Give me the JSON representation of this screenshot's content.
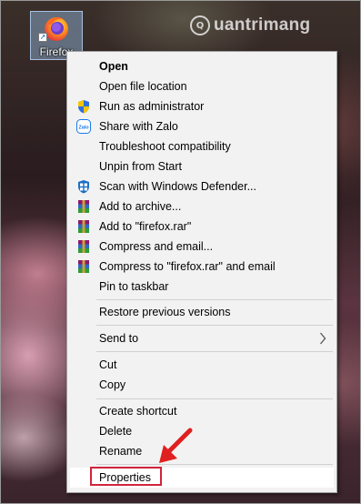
{
  "desktop": {
    "icon_label": "Firefox",
    "watermark_text": "uantrimang"
  },
  "menu": {
    "items": [
      {
        "label": "Open",
        "bold": true,
        "icon": "none"
      },
      {
        "label": "Open file location",
        "icon": "none"
      },
      {
        "label": "Run as administrator",
        "icon": "uac-shield-icon"
      },
      {
        "label": "Share with Zalo",
        "icon": "zalo-icon"
      },
      {
        "label": "Troubleshoot compatibility",
        "icon": "none"
      },
      {
        "label": "Unpin from Start",
        "icon": "none"
      },
      {
        "label": "Scan with Windows Defender...",
        "icon": "windows-defender-icon"
      },
      {
        "label": "Add to archive...",
        "icon": "winrar-icon"
      },
      {
        "label": "Add to \"firefox.rar\"",
        "icon": "winrar-icon"
      },
      {
        "label": "Compress and email...",
        "icon": "winrar-icon"
      },
      {
        "label": "Compress to \"firefox.rar\" and email",
        "icon": "winrar-icon"
      },
      {
        "label": "Pin to taskbar",
        "icon": "none"
      },
      {
        "label": "Restore previous versions",
        "icon": "none"
      },
      {
        "label": "Send to",
        "icon": "none",
        "submenu": true
      },
      {
        "label": "Cut",
        "icon": "none"
      },
      {
        "label": "Copy",
        "icon": "none"
      },
      {
        "label": "Create shortcut",
        "icon": "none"
      },
      {
        "label": "Delete",
        "icon": "none"
      },
      {
        "label": "Rename",
        "icon": "none"
      },
      {
        "label": "Properties",
        "icon": "none",
        "highlighted": true
      }
    ]
  },
  "colors": {
    "menu_bg": "#f2f2f2",
    "highlight_border": "#d0243c",
    "annotation_arrow": "#e02020"
  }
}
